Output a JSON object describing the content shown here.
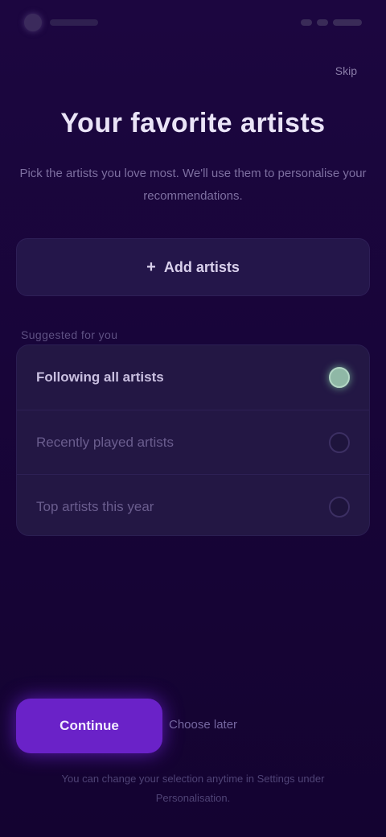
{
  "header": {
    "skip_label": "Skip"
  },
  "title": "Your favorite artists",
  "subtitle": "Pick the artists you love most. We'll use them to personalise your recommendations.",
  "add_artist": {
    "icon": "plus-icon",
    "label": "Add artists"
  },
  "section_label": "Suggested for you",
  "list_items": [
    {
      "label": "Following all artists",
      "selected": true
    },
    {
      "label": "Recently played artists",
      "selected": false
    },
    {
      "label": "Top artists this year",
      "selected": false
    }
  ],
  "actions": {
    "continue_label": "Continue",
    "secondary_label": "Choose later"
  },
  "footnote": "You can change your selection anytime in Settings under Personalisation."
}
